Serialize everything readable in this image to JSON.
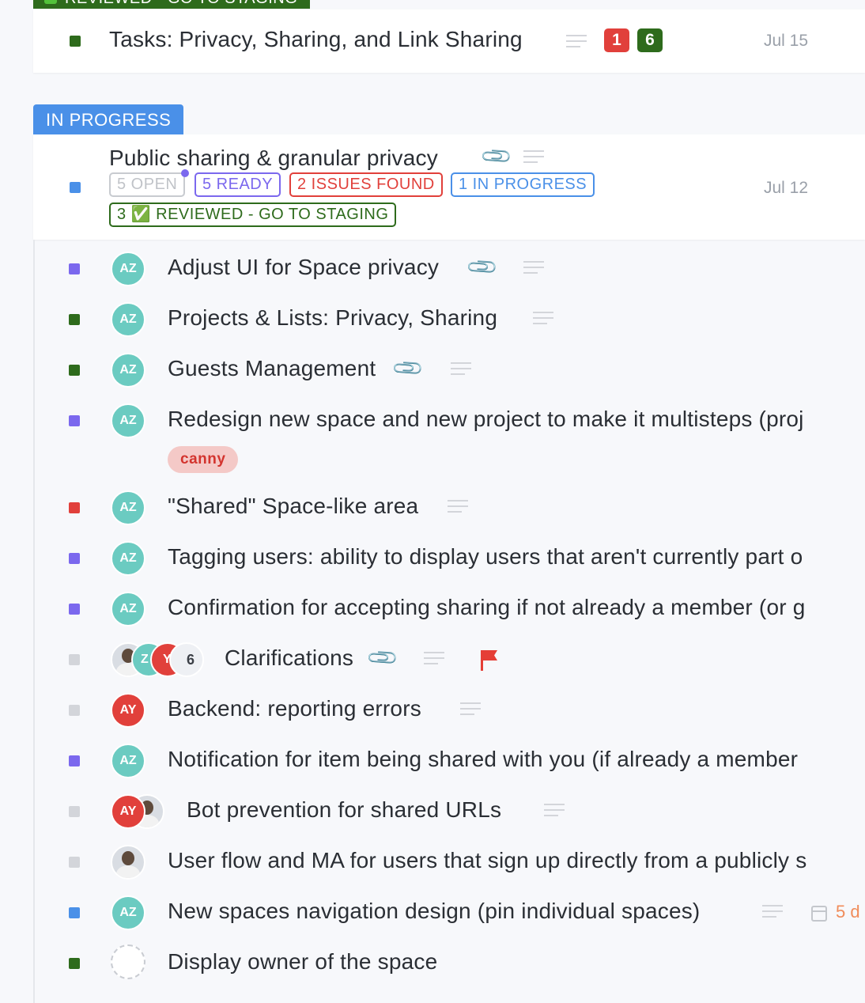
{
  "top_group": {
    "status_label": "REVIEWED - GO TO STAGING",
    "task": {
      "title": "Tasks: Privacy, Sharing, and Link Sharing",
      "badge_red": "1",
      "badge_green": "6",
      "date": "Jul 15"
    }
  },
  "in_progress": {
    "status_label": "IN PROGRESS",
    "task": {
      "title": "Public sharing & granular privacy",
      "date": "Jul 12",
      "pills": [
        "5 OPEN",
        "5 READY",
        "2 ISSUES FOUND",
        "1 IN PROGRESS",
        "3 ✅ REVIEWED - GO TO STAGING"
      ]
    }
  },
  "subtasks": [
    {
      "title": "Adjust UI for Space privacy",
      "avatar": "AZ"
    },
    {
      "title": "Projects & Lists: Privacy, Sharing",
      "avatar": "AZ"
    },
    {
      "title": "Guests Management",
      "avatar": "AZ"
    },
    {
      "title": "Redesign new space and new project to make it multisteps (proj",
      "avatar": "AZ",
      "tag": "canny"
    },
    {
      "title": "\"Shared\" Space-like area",
      "avatar": "AZ"
    },
    {
      "title": "Tagging users: ability to display users that aren't currently part o",
      "avatar": "AZ"
    },
    {
      "title": "Confirmation for accepting sharing if not already a member (or g",
      "avatar": "AZ"
    },
    {
      "title": "Clarifications",
      "avatar_partial_1": "Z",
      "avatar_partial_2": "Y",
      "avatar_more": "6"
    },
    {
      "title": "Backend: reporting errors",
      "avatar": "AY"
    },
    {
      "title": "Notification for item being shared with you (if already a member",
      "avatar": "AZ"
    },
    {
      "title": "Bot prevention for shared URLs",
      "avatar": "AY"
    },
    {
      "title": "User flow and MA for users that sign up directly from a publicly s"
    },
    {
      "title": "New spaces navigation design (pin individual spaces)",
      "avatar": "AZ",
      "due": "5 d"
    },
    {
      "title": "Display owner of the space"
    }
  ],
  "colors": {
    "green": "#2e6b1c",
    "blue": "#4a90e8",
    "purple": "#7b68ee",
    "red": "#e1403b",
    "gray": "#d3d5da"
  }
}
